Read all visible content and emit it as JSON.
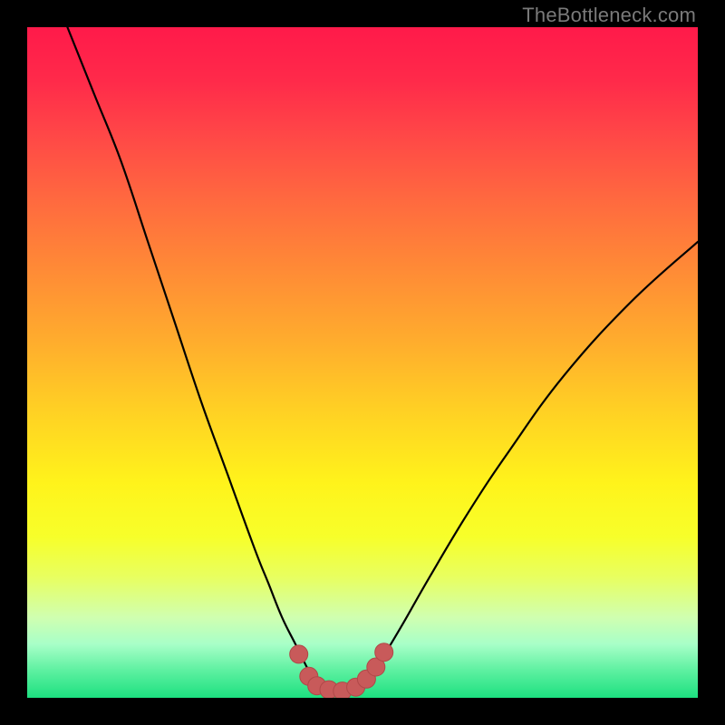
{
  "watermark": "TheBottleneck.com",
  "colors": {
    "curve": "#000000",
    "marker_fill": "#c85a5a",
    "marker_stroke": "#b04848",
    "frame": "#000000"
  },
  "chart_data": {
    "type": "line",
    "title": "",
    "xlabel": "",
    "ylabel": "",
    "xlim": [
      0,
      100
    ],
    "ylim": [
      0,
      100
    ],
    "grid": false,
    "note": "No axis ticks or numeric labels are shown; values are estimated from curve shape over a 0–100 normalized range.",
    "series": [
      {
        "name": "bottleneck-curve",
        "x": [
          6,
          10,
          14,
          18,
          22,
          26,
          30,
          34,
          36,
          38,
          40,
          42,
          43,
          45,
          47,
          49,
          51,
          53,
          56,
          60,
          66,
          72,
          80,
          90,
          100
        ],
        "y": [
          100,
          90,
          80,
          68,
          56,
          44,
          33,
          22,
          17,
          12,
          8,
          4,
          2.5,
          1.5,
          1,
          1.5,
          3,
          6,
          11,
          18,
          28,
          37,
          48,
          59,
          68
        ]
      }
    ],
    "markers": {
      "name": "bottom-beads",
      "points": [
        {
          "x": 40.5,
          "y": 6.5
        },
        {
          "x": 42.0,
          "y": 3.2
        },
        {
          "x": 43.2,
          "y": 1.8
        },
        {
          "x": 45.0,
          "y": 1.2
        },
        {
          "x": 47.0,
          "y": 1.0
        },
        {
          "x": 49.0,
          "y": 1.6
        },
        {
          "x": 50.6,
          "y": 2.8
        },
        {
          "x": 52.0,
          "y": 4.6
        },
        {
          "x": 53.2,
          "y": 6.8
        }
      ],
      "radius": 10
    }
  }
}
